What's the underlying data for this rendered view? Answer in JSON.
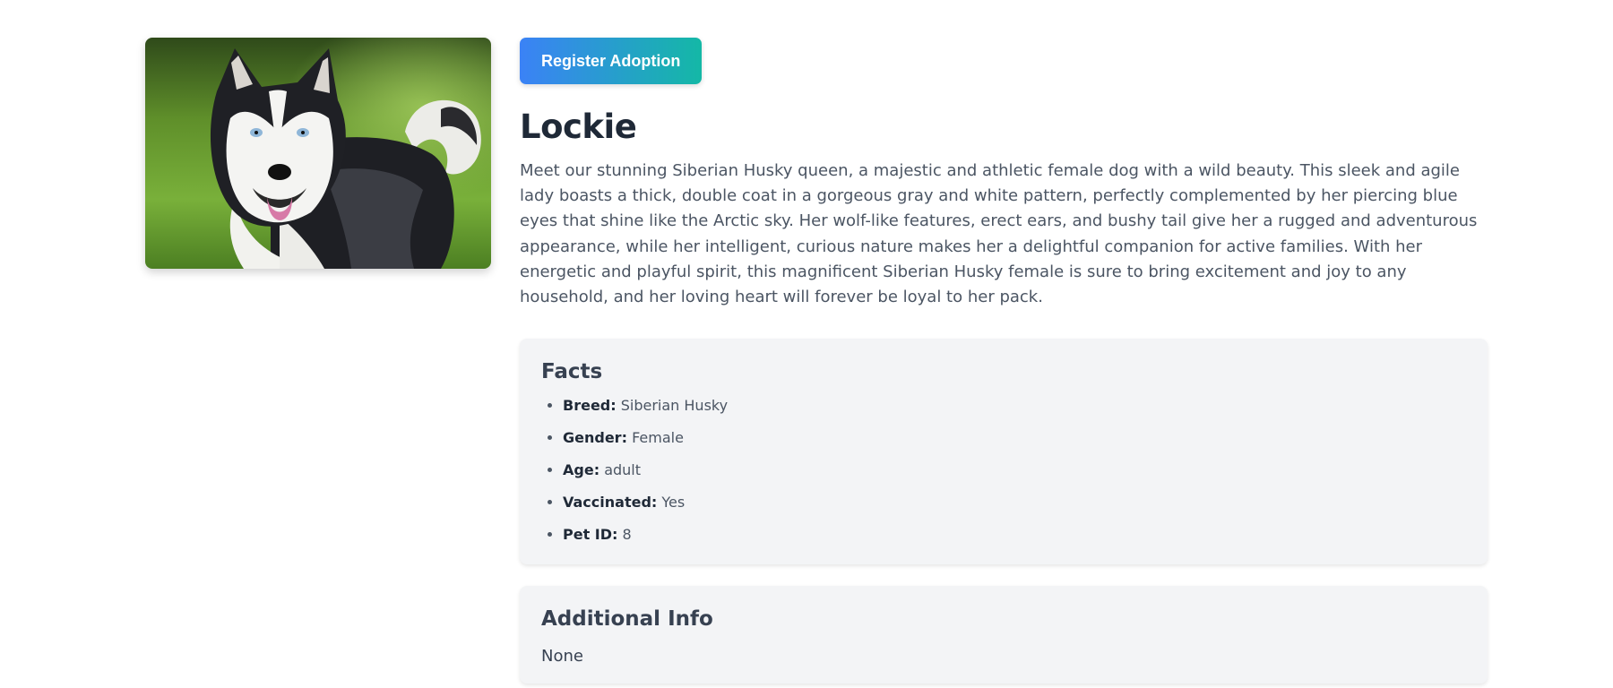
{
  "pet": {
    "image_alt": "Siberian Husky dog photo",
    "register_label": "Register Adoption",
    "name": "Lockie",
    "description": "Meet our stunning Siberian Husky queen, a majestic and athletic female dog with a wild beauty. This sleek and agile lady boasts a thick, double coat in a gorgeous gray and white pattern, perfectly complemented by her piercing blue eyes that shine like the Arctic sky. Her wolf-like features, erect ears, and bushy tail give her a rugged and adventurous appearance, while her intelligent, curious nature makes her a delightful companion for active families. With her energetic and playful spirit, this magnificent Siberian Husky female is sure to bring excitement and joy to any household, and her loving heart will forever be loyal to her pack."
  },
  "facts": {
    "title": "Facts",
    "items": [
      {
        "label": "Breed:",
        "value": "Siberian Husky"
      },
      {
        "label": "Gender:",
        "value": "Female"
      },
      {
        "label": "Age:",
        "value": "adult"
      },
      {
        "label": "Vaccinated:",
        "value": "Yes"
      },
      {
        "label": "Pet ID:",
        "value": "8"
      }
    ]
  },
  "additional": {
    "title": "Additional Info",
    "text": "None"
  }
}
